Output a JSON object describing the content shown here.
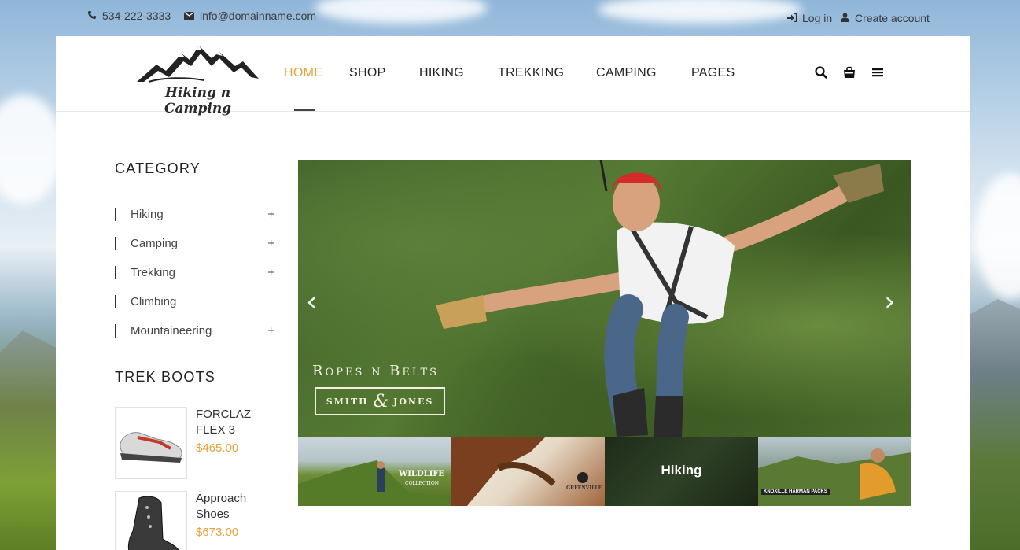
{
  "topbar": {
    "phone": "534-222-3333",
    "email": "info@domainname.com",
    "login": "Log in",
    "create_account": "Create account"
  },
  "logo": {
    "text": "Hiking n Camping"
  },
  "nav": {
    "items": [
      "HOME",
      "SHOP",
      "HIKING",
      "TREKKING",
      "CAMPING",
      "PAGES"
    ],
    "active": "HOME"
  },
  "header_icons": [
    "search-icon",
    "shopping-bag-icon",
    "menu-icon"
  ],
  "sidebar": {
    "category_title": "CATEGORY",
    "categories": [
      {
        "label": "Hiking",
        "expandable": "+"
      },
      {
        "label": "Camping",
        "expandable": "+"
      },
      {
        "label": "Trekking",
        "expandable": "+"
      },
      {
        "label": "Climbing",
        "expandable": ""
      },
      {
        "label": "Mountaineering",
        "expandable": "+"
      }
    ],
    "boots_title": "TREK BOOTS",
    "products": [
      {
        "name": "FORCLAZ FLEX 3",
        "price": "$465.00"
      },
      {
        "name": "Approach Shoes",
        "price": "$673.00"
      }
    ]
  },
  "slider": {
    "brand_line": "Ropes n Belts",
    "brand_left": "SMITH",
    "brand_amp": "&",
    "brand_right": "JONES",
    "prev": "‹",
    "next": "›"
  },
  "thumbnails": [
    {
      "title": "WILDLIFE",
      "subtitle": "COLLECTION"
    },
    {
      "title": "GREENVILLE",
      "subtitle": ""
    },
    {
      "title": "Hiking",
      "subtitle": ""
    },
    {
      "title": "KNOXILLE HARMAN PACKS",
      "subtitle": ""
    }
  ],
  "colors": {
    "accent": "#e6a23c",
    "text": "#333333",
    "panel": "#ffffff"
  }
}
